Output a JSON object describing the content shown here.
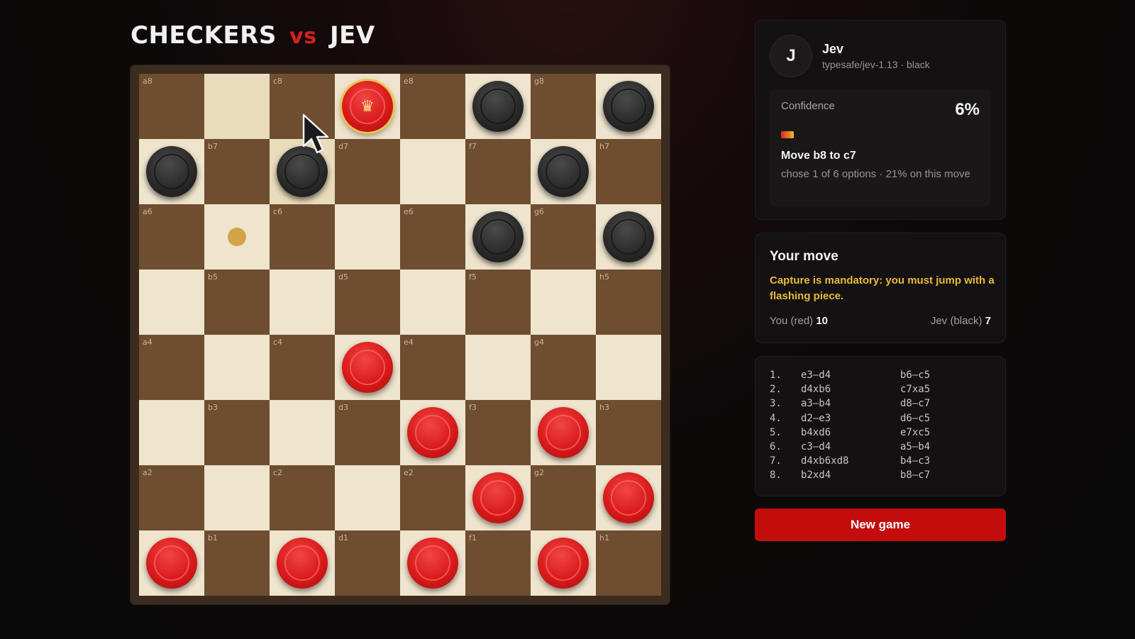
{
  "title": {
    "left": "CHECKERS",
    "vs": "vs",
    "right": "JEV"
  },
  "board": {
    "files": [
      "a",
      "b",
      "c",
      "d",
      "e",
      "f",
      "g",
      "h"
    ],
    "highlight": [
      "b8",
      "c7"
    ],
    "move_hint": [
      "b6"
    ],
    "pieces": {
      "d8": "red-king",
      "f8": "black",
      "h8": "black",
      "a7": "black",
      "c7": "black",
      "g7": "black",
      "f6": "black",
      "h6": "black",
      "d4": "red",
      "e3": "red",
      "g3": "red",
      "f2": "red",
      "h2": "red",
      "a1": "red",
      "c1": "red",
      "e1": "red",
      "g1": "red"
    },
    "king_icon": "crown-icon",
    "colors": {
      "light": "#efe4cd",
      "dark": "#6e4d30",
      "highlight": "#8a6530",
      "red": "#d81a1a",
      "black": "#2a2a2a",
      "king_ring": "#f0c24a",
      "hint": "#d1a448"
    }
  },
  "opponent": {
    "avatar_letter": "J",
    "name": "Jev",
    "subtitle": "typesafe/jev-1.13 · black",
    "confidence_label": "Confidence",
    "confidence_value": "6%",
    "confidence_fraction": 0.06,
    "last_move": "Move b8 to c7",
    "detail": "chose 1 of 6 options · 21% on this move"
  },
  "your_move": {
    "title": "Your move",
    "warning": "Capture is mandatory: you must jump with a flashing piece.",
    "you_label": "You (red)",
    "you_count": "10",
    "jev_label": "Jev (black)",
    "jev_count": "7"
  },
  "move_list": [
    {
      "num": "1.",
      "white": "e3–d4",
      "black": "b6–c5"
    },
    {
      "num": "2.",
      "white": "d4xb6",
      "black": "c7xa5"
    },
    {
      "num": "3.",
      "white": "a3–b4",
      "black": "d8–c7"
    },
    {
      "num": "4.",
      "white": "d2–e3",
      "black": "d6–c5"
    },
    {
      "num": "5.",
      "white": "b4xd6",
      "black": "e7xc5"
    },
    {
      "num": "6.",
      "white": "c3–d4",
      "black": "a5–b4"
    },
    {
      "num": "7.",
      "white": "d4xb6xd8",
      "black": "b4–c3"
    },
    {
      "num": "8.",
      "white": "b2xd4",
      "black": "b8–c7"
    }
  ],
  "buttons": {
    "new_game": "New game"
  },
  "accent": "#c30d0d"
}
